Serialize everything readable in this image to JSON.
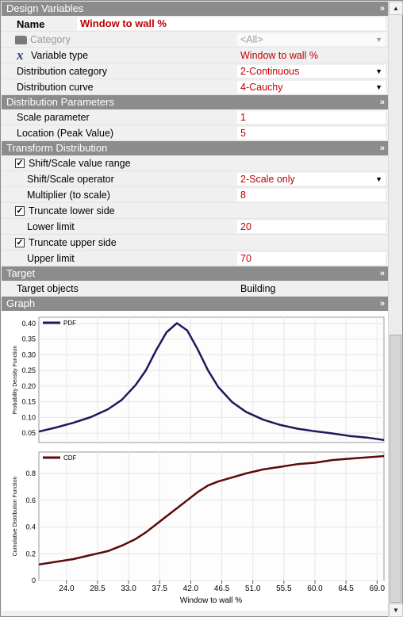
{
  "sections": {
    "design_variables": "Design Variables",
    "distribution_parameters": "Distribution Parameters",
    "transform_distribution": "Transform Distribution",
    "target": "Target",
    "graph": "Graph"
  },
  "design": {
    "name_label": "Name",
    "name_value": "Window to wall %",
    "category_label": "Category",
    "category_value": "<All>",
    "variable_type_label": "Variable type",
    "variable_type_value": "Window to wall %",
    "dist_category_label": "Distribution category",
    "dist_category_value": "2-Continuous",
    "dist_curve_label": "Distribution curve",
    "dist_curve_value": "4-Cauchy"
  },
  "params": {
    "scale_label": "Scale parameter",
    "scale_value": "1",
    "location_label": "Location (Peak Value)",
    "location_value": "5"
  },
  "transform": {
    "shift_scale_label": "Shift/Scale value range",
    "shift_scale_checked": true,
    "operator_label": "Shift/Scale operator",
    "operator_value": "2-Scale only",
    "multiplier_label": "Multiplier (to scale)",
    "multiplier_value": "8",
    "truncate_lower_label": "Truncate lower side",
    "truncate_lower_checked": true,
    "lower_limit_label": "Lower limit",
    "lower_limit_value": "20",
    "truncate_upper_label": "Truncate upper side",
    "truncate_upper_checked": true,
    "upper_limit_label": "Upper limit",
    "upper_limit_value": "70"
  },
  "target": {
    "objects_label": "Target objects",
    "objects_value": "Building"
  },
  "icons": {
    "collapse": "double-chevron-up-icon",
    "dropdown": "triangle-down-icon",
    "folder": "folder-icon",
    "variable": "x-variable-icon"
  },
  "colors": {
    "pdf_line": "#1a1a5e",
    "cdf_line": "#5c0a0a",
    "header_bg": "#8c8c8c",
    "value_red": "#c00000"
  },
  "chart_data": [
    {
      "type": "line",
      "legend": "PDF",
      "ylabel": "Probability Density Function",
      "ylim": [
        0.02,
        0.42
      ],
      "yticks": [
        "0.05",
        "0.10",
        "0.15",
        "0.20",
        "0.25",
        "0.30",
        "0.35",
        "0.40"
      ],
      "xlim": [
        20,
        70
      ],
      "x": [
        20,
        22.5,
        25,
        27.5,
        30,
        32,
        34,
        35.5,
        37,
        38.5,
        40,
        41.5,
        43,
        44.5,
        46,
        48,
        50,
        52.5,
        55,
        57.5,
        60,
        62.5,
        65,
        67.5,
        70
      ],
      "y": [
        0.055,
        0.068,
        0.083,
        0.101,
        0.126,
        0.156,
        0.203,
        0.25,
        0.315,
        0.372,
        0.401,
        0.378,
        0.318,
        0.251,
        0.197,
        0.149,
        0.118,
        0.093,
        0.076,
        0.064,
        0.056,
        0.049,
        0.041,
        0.036,
        0.028
      ]
    },
    {
      "type": "line",
      "legend": "CDF",
      "ylabel": "Cumulative Distribution Function",
      "xlabel": "Window to wall %",
      "ylim": [
        0.0,
        0.96
      ],
      "yticks": [
        "0",
        "0.2",
        "0.4",
        "0.6",
        "0.8"
      ],
      "xlim": [
        20,
        70
      ],
      "xticks": [
        "24.0",
        "28.5",
        "33.0",
        "37.5",
        "42.0",
        "46.5",
        "51.0",
        "55.5",
        "60.0",
        "64.5",
        "69.0"
      ],
      "x": [
        20,
        22.5,
        25,
        27.5,
        30,
        32,
        34,
        35.5,
        37,
        38.5,
        40,
        41.5,
        43,
        44.5,
        46,
        48,
        50,
        52.5,
        55,
        57.5,
        60,
        62.5,
        65,
        67.5,
        70
      ],
      "y": [
        0.12,
        0.14,
        0.16,
        0.19,
        0.22,
        0.26,
        0.31,
        0.36,
        0.42,
        0.48,
        0.54,
        0.6,
        0.66,
        0.71,
        0.74,
        0.77,
        0.8,
        0.83,
        0.85,
        0.87,
        0.88,
        0.9,
        0.91,
        0.92,
        0.93
      ]
    }
  ]
}
